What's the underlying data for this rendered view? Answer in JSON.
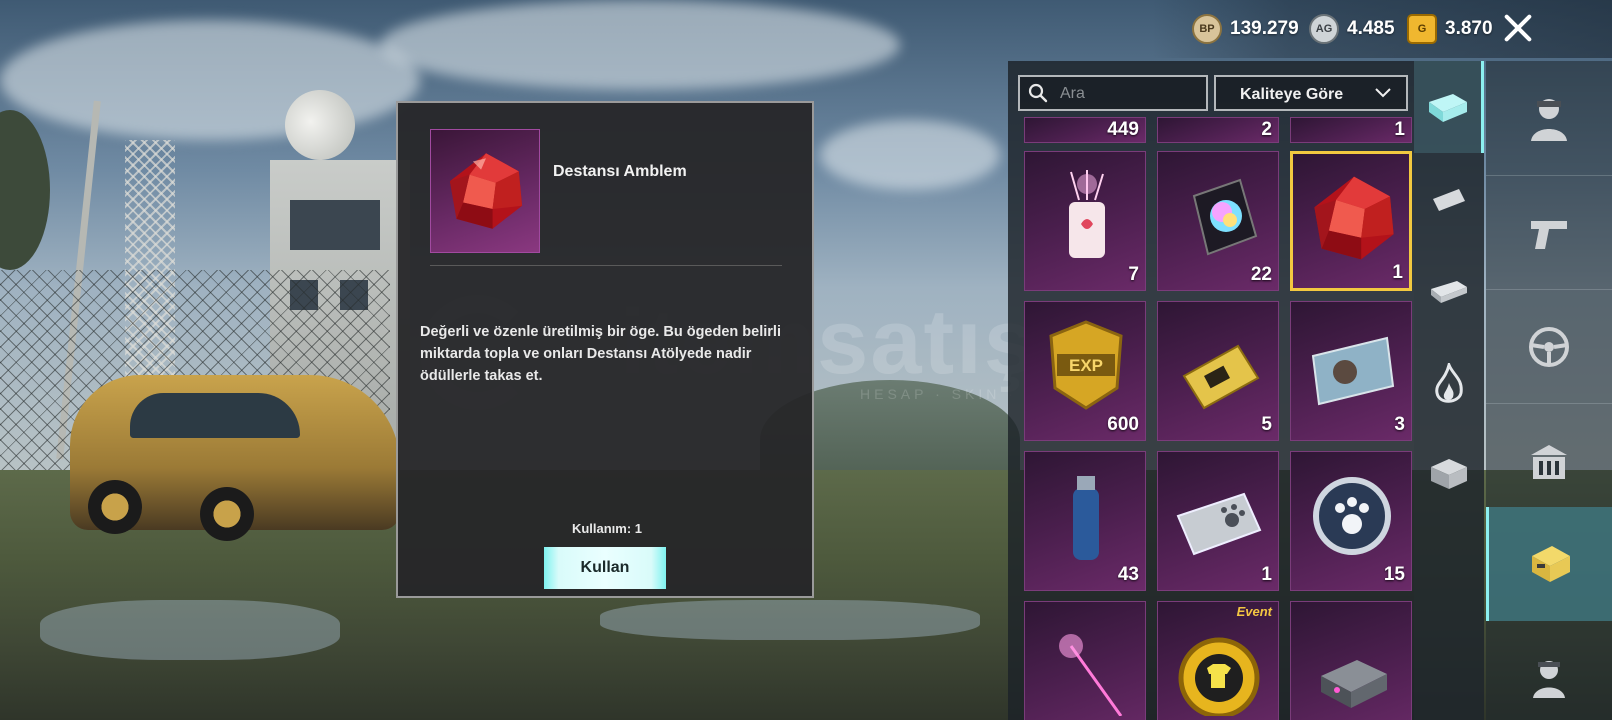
{
  "currencies": [
    {
      "icon": "bp-coin-icon",
      "icon_text": "BP",
      "value": "139.279"
    },
    {
      "icon": "ag-coin-icon",
      "icon_text": "AG",
      "value": "4.485"
    },
    {
      "icon": "uc-coin-icon",
      "icon_text": "G",
      "value": "3.870"
    }
  ],
  "detail": {
    "item_name": "Destansı Amblem",
    "description": "Değerli ve özenle üretilmiş bir öge. Bu ögeden belirli miktarda topla ve onları Destansı Atölyede nadir ödüllerle takas et.",
    "usage_label": "Kullanım: 1",
    "use_button": "Kullan"
  },
  "inventory": {
    "search_placeholder": "Ara",
    "sort_label": "Kaliteye Göre",
    "top_partial_counts": [
      "449",
      "2",
      "1"
    ],
    "items": [
      {
        "name": "confetti-cup-item",
        "count": "7"
      },
      {
        "name": "rainbow-orb-card-item",
        "count": "22"
      },
      {
        "name": "epic-emblem-item",
        "count": "1",
        "selected": true
      },
      {
        "name": "exp-card-item",
        "count": "600"
      },
      {
        "name": "gold-ticket-item",
        "count": "5"
      },
      {
        "name": "player-card-item",
        "count": "3"
      },
      {
        "name": "spray-can-item",
        "count": "43"
      },
      {
        "name": "paw-ticket-item",
        "count": "1"
      },
      {
        "name": "paw-coin-item",
        "count": "15"
      },
      {
        "name": "pink-wand-item",
        "count": ""
      },
      {
        "name": "event-shirt-coin-item",
        "count": "",
        "tag": "Event"
      },
      {
        "name": "crate-device-item",
        "count": ""
      }
    ]
  },
  "colors": {
    "accent": "#8cf0f0",
    "selected_border": "#f2c940",
    "slot_purple": "#4b1f4e"
  }
}
